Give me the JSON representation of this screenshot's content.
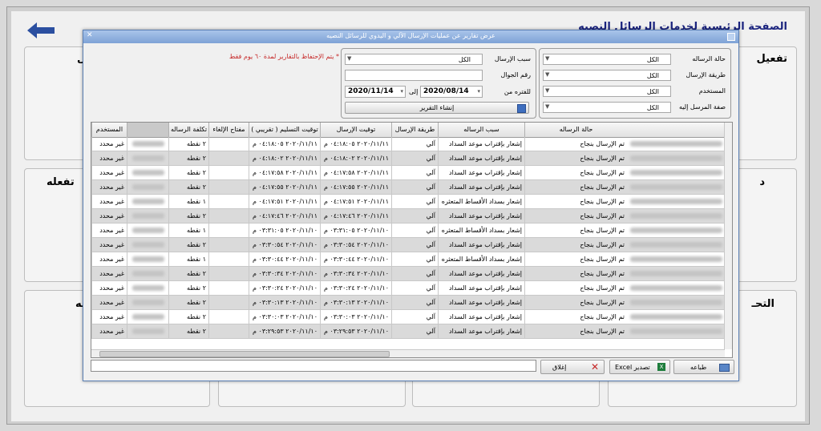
{
  "background": {
    "title": "الصفحة الرئيسية لخدمات الرسائل النصيه",
    "tiles": [
      "تفعيل",
      "تفعله",
      "التحـ",
      "يه",
      "ل",
      "د"
    ]
  },
  "dialog": {
    "title": "عرض تقارير عن عمليات الإرسال الآلي و اليدوي للرسائل النصيه"
  },
  "filters": {
    "message_status": {
      "label": "حالة الرساله",
      "value": "الكل"
    },
    "send_method": {
      "label": "طريقة الإرسال",
      "value": "الكل"
    },
    "user": {
      "label": "المستخدم",
      "value": "الكل"
    },
    "recipient_type": {
      "label": "صفة المرسل إليه",
      "value": "الكل"
    },
    "send_reason": {
      "label": "سبب الإرسال",
      "value": "الكل"
    },
    "mobile": {
      "label": "رقم الجوال",
      "value": ""
    },
    "period_from": {
      "label": "للفتره من",
      "value": "2020/08/14"
    },
    "period_to": {
      "label": "إلى",
      "value": "2020/11/14"
    },
    "create_report": "إنشاء التقرير",
    "retention_note": "* يتم الإحتفاظ بالتقارير لمدة ٦٠ يوم فقط"
  },
  "grid": {
    "columns": [
      "حالة الرساله",
      "سبب الرساله",
      "طريقة الإرسال",
      "توقيت الإرسال",
      "توقيت التسليم ( تقريبي )",
      "مفتاح الإلغاء",
      "تكلفة الرساله",
      "",
      "المستخدم"
    ],
    "rows": [
      {
        "status": "تم الإرسال بنجاح",
        "reason": "إشعار بإقتراب موعد السداد",
        "method": "آلي",
        "sent": "٢٠٢٠/١١/١١ ٠٤:١٨:٠٥ م",
        "delivered": "٢٠٢٠/١١/١١ ٠٤:١٨:٠٥ م",
        "cancel_key": "",
        "cost": "٢ نقطه",
        "user": "غير محدد"
      },
      {
        "status": "تم الإرسال بنجاح",
        "reason": "إشعار بإقتراب موعد السداد",
        "method": "آلي",
        "sent": "٢٠٢٠/١١/١١ ٠٤:١٨:٠٢ م",
        "delivered": "٢٠٢٠/١١/١١ ٠٤:١٨:٠٢ م",
        "cancel_key": "",
        "cost": "٢ نقطه",
        "user": "غير محدد"
      },
      {
        "status": "تم الإرسال بنجاح",
        "reason": "إشعار بإقتراب موعد السداد",
        "method": "آلي",
        "sent": "٢٠٢٠/١١/١١ ٠٤:١٧:٥٨ م",
        "delivered": "٢٠٢٠/١١/١١ ٠٤:١٧:٥٨ م",
        "cancel_key": "",
        "cost": "٢ نقطه",
        "user": "غير محدد"
      },
      {
        "status": "تم الإرسال بنجاح",
        "reason": "إشعار بإقتراب موعد السداد",
        "method": "آلي",
        "sent": "٢٠٢٠/١١/١١ ٠٤:١٧:٥٥ م",
        "delivered": "٢٠٢٠/١١/١١ ٠٤:١٧:٥٥ م",
        "cancel_key": "",
        "cost": "٢ نقطه",
        "user": "غير محدد"
      },
      {
        "status": "تم الإرسال بنجاح",
        "reason": "إشعار بسداد الأقساط المتعثره",
        "method": "آلي",
        "sent": "٢٠٢٠/١١/١١ ٠٤:١٧:٥١ م",
        "delivered": "٢٠٢٠/١١/١١ ٠٤:١٧:٥١ م",
        "cancel_key": "",
        "cost": "١ نقطه",
        "user": "غير محدد"
      },
      {
        "status": "تم الإرسال بنجاح",
        "reason": "إشعار بإقتراب موعد السداد",
        "method": "آلي",
        "sent": "٢٠٢٠/١١/١١ ٠٤:١٧:٤٦ م",
        "delivered": "٢٠٢٠/١١/١١ ٠٤:١٧:٤٦ م",
        "cancel_key": "",
        "cost": "٢ نقطه",
        "user": "غير محدد"
      },
      {
        "status": "تم الإرسال بنجاح",
        "reason": "إشعار بسداد الأقساط المتعثره",
        "method": "آلي",
        "sent": "٢٠٢٠/١١/١٠ ٠٣:٣١:٠٥ م",
        "delivered": "٢٠٢٠/١١/١٠ ٠٣:٣١:٠٥ م",
        "cancel_key": "",
        "cost": "١ نقطه",
        "user": "غير محدد"
      },
      {
        "status": "تم الإرسال بنجاح",
        "reason": "إشعار بإقتراب موعد السداد",
        "method": "آلي",
        "sent": "٢٠٢٠/١١/١٠ ٠٣:٣٠:٥٤ م",
        "delivered": "٢٠٢٠/١١/١٠ ٠٣:٣٠:٥٤ م",
        "cancel_key": "",
        "cost": "٢ نقطه",
        "user": "غير محدد"
      },
      {
        "status": "تم الإرسال بنجاح",
        "reason": "إشعار بسداد الأقساط المتعثره",
        "method": "آلي",
        "sent": "٢٠٢٠/١١/١٠ ٠٣:٣٠:٤٤ م",
        "delivered": "٢٠٢٠/١١/١٠ ٠٣:٣٠:٤٤ م",
        "cancel_key": "",
        "cost": "١ نقطه",
        "user": "غير محدد"
      },
      {
        "status": "تم الإرسال بنجاح",
        "reason": "إشعار بإقتراب موعد السداد",
        "method": "آلي",
        "sent": "٢٠٢٠/١١/١٠ ٠٣:٣٠:٣٤ م",
        "delivered": "٢٠٢٠/١١/١٠ ٠٣:٣٠:٣٤ م",
        "cancel_key": "",
        "cost": "٢ نقطه",
        "user": "غير محدد"
      },
      {
        "status": "تم الإرسال بنجاح",
        "reason": "إشعار بإقتراب موعد السداد",
        "method": "آلي",
        "sent": "٢٠٢٠/١١/١٠ ٠٣:٣٠:٢٤ م",
        "delivered": "٢٠٢٠/١١/١٠ ٠٣:٣٠:٢٤ م",
        "cancel_key": "",
        "cost": "٢ نقطه",
        "user": "غير محدد"
      },
      {
        "status": "تم الإرسال بنجاح",
        "reason": "إشعار بإقتراب موعد السداد",
        "method": "آلي",
        "sent": "٢٠٢٠/١١/١٠ ٠٣:٣٠:١٣ م",
        "delivered": "٢٠٢٠/١١/١٠ ٠٣:٣٠:١٣ م",
        "cancel_key": "",
        "cost": "٢ نقطه",
        "user": "غير محدد"
      },
      {
        "status": "تم الإرسال بنجاح",
        "reason": "إشعار بإقتراب موعد السداد",
        "method": "آلي",
        "sent": "٢٠٢٠/١١/١٠ ٠٣:٣٠:٠٣ م",
        "delivered": "٢٠٢٠/١١/١٠ ٠٣:٣٠:٠٣ م",
        "cancel_key": "",
        "cost": "٢ نقطه",
        "user": "غير محدد"
      },
      {
        "status": "تم الإرسال بنجاح",
        "reason": "إشعار بإقتراب موعد السداد",
        "method": "آلي",
        "sent": "٢٠٢٠/١١/١٠ ٠٣:٢٩:٥٣ م",
        "delivered": "٢٠٢٠/١١/١٠ ٠٣:٢٩:٥٣ م",
        "cancel_key": "",
        "cost": "٢ نقطه",
        "user": "غير محدد"
      }
    ]
  },
  "footer": {
    "print": "طباعه",
    "export_excel": "تصدير Excel",
    "close": "إغلاق"
  },
  "colors": {
    "title_blue": "#1a237e",
    "note_red": "#c62828",
    "titlebar": "#7ea3d6"
  }
}
